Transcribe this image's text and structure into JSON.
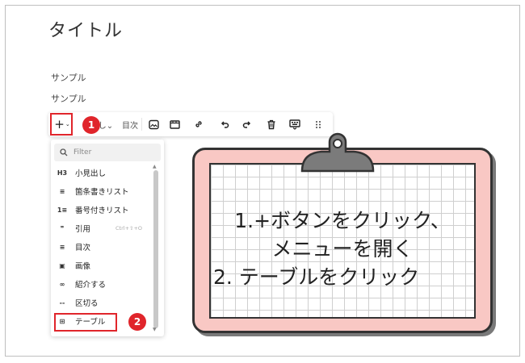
{
  "editor": {
    "title": "タイトル",
    "paragraphs": [
      "サンプル",
      "サンプル"
    ]
  },
  "toolbar": {
    "plus_label": "+",
    "plus_chevron": "⌄",
    "heading_label": "し⌄",
    "toc_label": "目次"
  },
  "badges": {
    "step1": "1",
    "step2": "2"
  },
  "dropdown": {
    "filter_placeholder": "Filter",
    "items": [
      {
        "icon": "H3",
        "label": "小見出し",
        "shortcut": ""
      },
      {
        "icon": "≡",
        "label": "箇条書きリスト",
        "shortcut": ""
      },
      {
        "icon": "1≡",
        "label": "番号付きリスト",
        "shortcut": ""
      },
      {
        "icon": "❞",
        "label": "引用",
        "shortcut": "Ctrl+⇧+O"
      },
      {
        "icon": "≡",
        "label": "目次",
        "shortcut": ""
      },
      {
        "icon": "▣",
        "label": "画像",
        "shortcut": ""
      },
      {
        "icon": "∞",
        "label": "紹介する",
        "shortcut": ""
      },
      {
        "icon": "--",
        "label": "区切る",
        "shortcut": ""
      },
      {
        "icon": "⊞",
        "label": "テーブル",
        "shortcut": ""
      }
    ]
  },
  "instructions": {
    "line1": "1.+ボタンをクリック、",
    "line2": "メニューを開く",
    "line3": "2. テーブルをクリック"
  },
  "colors": {
    "accent_red": "#e0252b",
    "clipboard_pink": "#f9c8c4"
  }
}
